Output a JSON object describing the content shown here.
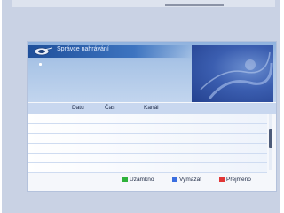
{
  "title": "Správce nahrávání",
  "columns": {
    "date": "Datu",
    "time": "Čas",
    "channel": "Kanál"
  },
  "rows_count": 6,
  "legend": [
    {
      "color": "#2fb23b",
      "label": "Uzamkno"
    },
    {
      "color": "#3a6ee0",
      "label": "Vymazat"
    },
    {
      "color": "#e13636",
      "label": "Přejmeno"
    }
  ],
  "colors": {
    "accent": "#3d74c0",
    "panel": "#f5f7fb",
    "header": "#a9c4e6"
  },
  "icons": {
    "logo": "satellite-dish-icon"
  }
}
